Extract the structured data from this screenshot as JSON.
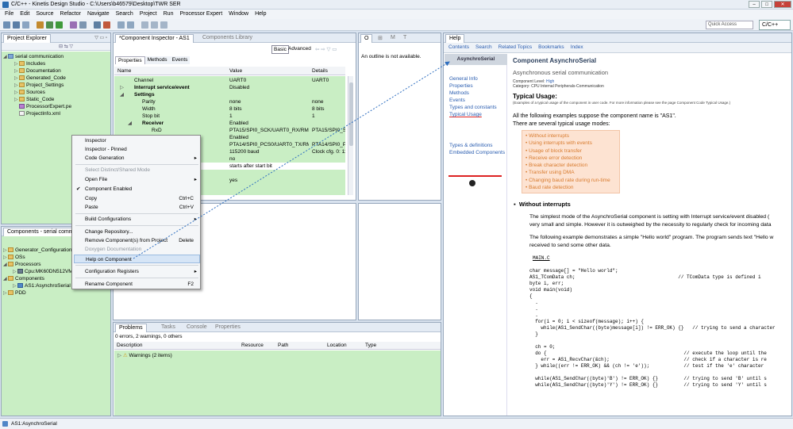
{
  "window": {
    "title": "C/C++ - Kinetis Design Studio - C:\\Users\\b46579\\Desktop\\TWR SER",
    "controls": [
      "–",
      "□",
      "✕"
    ]
  },
  "menu": [
    "File",
    "Edit",
    "Source",
    "Refactor",
    "Navigate",
    "Search",
    "Project",
    "Run",
    "Processor Expert",
    "Window",
    "Help"
  ],
  "toolbar": {
    "quick_access": "Quick Access",
    "perspective": "C/C++"
  },
  "project_explorer": {
    "tab": "Project Explorer",
    "project": "serial communication",
    "items": [
      "Includes",
      "Documentation",
      "Generated_Code",
      "Project_Settings",
      "Sources",
      "Static_Code",
      "ProcessorExpert.pe",
      "ProjectInfo.xml"
    ]
  },
  "components_view": {
    "tab": "Components - serial communication",
    "items": [
      "Generator_Configurations",
      "OSs",
      "Processors",
      "Cpu:MK60DN512VMD10",
      "Components",
      "AS1:AsynchroSerial",
      "PDD"
    ]
  },
  "inspector": {
    "tab": "*Component Inspector - AS1",
    "tab2": "Components Library",
    "mode_basic": "Basic",
    "mode_advanced": "Advanced",
    "subtabs": [
      "Properties",
      "Methods",
      "Events"
    ],
    "columns": [
      "Name",
      "Value",
      "Details"
    ],
    "rows": [
      {
        "name": "Channel",
        "value": "UART0",
        "details": "UART0"
      },
      {
        "name": "Interrupt service/event",
        "value": "Disabled",
        "details": ""
      },
      {
        "name": "Settings",
        "value": "",
        "details": ""
      },
      {
        "name": "Parity",
        "value": "none",
        "details": "none"
      },
      {
        "name": "Width",
        "value": "8 bits",
        "details": "8 bits"
      },
      {
        "name": "Stop bit",
        "value": "1",
        "details": "1"
      },
      {
        "name": "Receiver",
        "value": "Enabled",
        "details": ""
      },
      {
        "name": "RxD",
        "value": "PTA15/SPI0_SCK/UART0_RX/RMII0...",
        "details": "PTA15/SPI0_SCK"
      },
      {
        "name": "",
        "value": "Enabled",
        "details": ""
      },
      {
        "name": "",
        "value": "PTA14/SPI0_PCS0/UART0_TX/RMII...",
        "details": "PTA14/SPI0_PC"
      },
      {
        "name": "",
        "value": "115200 baud",
        "details": "Clock cfg. 0: 115"
      },
      {
        "name": "",
        "value": "no",
        "details": ""
      },
      {
        "name": "",
        "value": "starts after start bit",
        "details": ""
      },
      {
        "name": "",
        "value": "yes",
        "details": ""
      }
    ]
  },
  "context_menu": {
    "items": [
      {
        "label": "Inspector",
        "shortcut": ""
      },
      {
        "label": "Inspector - Pinned",
        "shortcut": ""
      },
      {
        "label": "Code Generation",
        "shortcut": ""
      },
      {
        "label": "Select Distinct/Shared Mode",
        "shortcut": ""
      },
      {
        "label": "Open File",
        "shortcut": ""
      },
      {
        "label": "Component Enabled",
        "shortcut": ""
      },
      {
        "label": "Copy",
        "shortcut": "Ctrl+C"
      },
      {
        "label": "Paste",
        "shortcut": "Ctrl+V"
      },
      {
        "label": "Build Configurations",
        "shortcut": ""
      },
      {
        "label": "Change Repository...",
        "shortcut": ""
      },
      {
        "label": "Remove Component(s) from Project",
        "shortcut": "Delete"
      },
      {
        "label": "Doxygen Documentation",
        "shortcut": ""
      },
      {
        "label": "Help on Component",
        "shortcut": ""
      },
      {
        "label": "Configuration Registers",
        "shortcut": ""
      },
      {
        "label": "Rename Component",
        "shortcut": "F2"
      }
    ]
  },
  "outline": {
    "tabs": [
      "O",
      "⊞",
      "M",
      "T"
    ],
    "message": "An outline is not available."
  },
  "problems": {
    "tabs": [
      "Problems",
      "Tasks",
      "Console",
      "Properties"
    ],
    "summary": "0 errors, 2 warnings, 0 others",
    "columns": [
      "Description",
      "Resource",
      "Path",
      "Location",
      "Type"
    ],
    "row": "Warnings (2 items)"
  },
  "help": {
    "tab": "Help",
    "nav": [
      "Contents",
      "Search",
      "Related Topics",
      "Bookmarks",
      "Index"
    ],
    "side_title": "AsynchroSerial",
    "side_links": [
      "General Info",
      "Properties",
      "Methods",
      "Events",
      "Types and constants",
      "Typical Usage",
      "Types & definitions",
      "Embedded Components"
    ],
    "title": "Component AsynchroSerial",
    "subtitle": "Asynchronous serial communication",
    "level_label": "Component Level:",
    "level_value": "High",
    "category_label": "Category:",
    "category_value": "CPU Internal Peripherals-Communication",
    "typical_usage": "Typical Usage:",
    "typical_note": "(Examples of a typical usage of the component in user code. For more information please see the page Component Code Typical Usage.)",
    "intro1": "All the following examples suppose the component name is \"AS1\".",
    "intro2": "There are several typical usage modes:",
    "modes": [
      "Without interrupts",
      "Using interrupts with events",
      "Usage of block transfer",
      "Receive error detection",
      "Break character detection",
      "Transfer using DMA",
      "Changing baud rate during run-time",
      "Baud rate detection"
    ],
    "section": "Without interrupts",
    "p1": "The simplest mode of the AsynchroSerial component is setting with Interrupt service/event disabled (",
    "p1b": "very small and simple. However it is outweighed by the necessity to regularly check for incoming data",
    "p2": "The following example demonstrates a simple \"Hello world\" program. The program sends text \"Hello w",
    "p2b": "received to send some other data.",
    "file": "MAIN.C",
    "code": "char message[] = \"Hello world\";\nAS1_TComData ch;                                    // TComData type is defined i\nbyte i, err;\nvoid main(void)\n{\n  .\n  .\n  .\n  for(i = 0; i < sizeof(message); i++) {\n    while(AS1_SendChar((byte)message[i]) != ERR_OK) {}   // trying to send a character\n  }\n\n  ch = 0;\n  do {                                                // execute the loop until the\n    err = AS1_RecvChar(&ch);                          // check if a character is re\n  } while((err != ERR_OK) && (ch != 'e'));            // test if the 'e' character\n\n  while(AS1_SendChar((byte)'B') != ERR_OK) {}         // trying to send 'B' until s\n  while(AS1_SendChar((byte)'Y') != ERR_OK) {}         // trying to send 'Y' until s"
  },
  "status": {
    "text": "AS1:AsynchroSerial"
  }
}
